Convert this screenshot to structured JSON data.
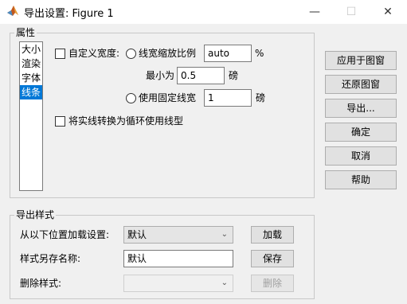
{
  "window": {
    "title": "导出设置: Figure 1",
    "minimize_glyph": "—",
    "maximize_glyph": "☐",
    "close_glyph": "✕"
  },
  "properties": {
    "group_title": "属性",
    "list_items": [
      "大小",
      "渲染",
      "字体",
      "线条"
    ],
    "selected_index": 3,
    "custom_width_label": "自定义宽度:",
    "custom_width_checked": false,
    "scale_radio_label": "线宽缩放比例",
    "scale_value": "auto",
    "scale_unit": "%",
    "min_label": "最小为",
    "min_value": "0.5",
    "min_unit": "磅",
    "fixed_radio_label": "使用固定线宽",
    "fixed_value": "1",
    "fixed_unit": "磅",
    "convert_label": "将实线转换为循环使用线型",
    "convert_checked": false
  },
  "side_buttons": {
    "apply": "应用于图窗",
    "restore": "还原图窗",
    "export": "导出...",
    "ok": "确定",
    "cancel": "取消",
    "help": "帮助"
  },
  "export_styles": {
    "group_title": "导出样式",
    "load_label": "从以下位置加载设置:",
    "load_value": "默认",
    "load_button": "加载",
    "save_label": "样式另存名称:",
    "save_value": "默认",
    "save_button": "保存",
    "delete_label": "删除样式:",
    "delete_value": "",
    "delete_button": "删除"
  }
}
